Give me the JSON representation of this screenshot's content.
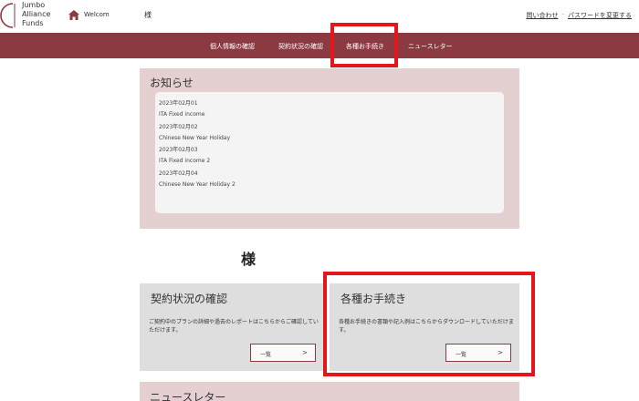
{
  "header": {
    "logo_lines": [
      "Jumbo",
      "Alliance",
      "Funds"
    ],
    "welcome": "Welcom",
    "user_suffix": "様",
    "contact_link": "問い合わせ",
    "separator": "-",
    "password_link": "パスワードを変更する"
  },
  "nav": {
    "items": [
      {
        "label": "個人情報の確認"
      },
      {
        "label": "契約状況の確認"
      },
      {
        "label": "各種お手続き"
      },
      {
        "label": "ニュースレター"
      }
    ]
  },
  "news": {
    "title": "お知らせ",
    "items": [
      {
        "date": "2023年02月01",
        "text": "ITA Fixed income"
      },
      {
        "date": "2023年02月02",
        "text": "Chinese New Year Holiday"
      },
      {
        "date": "2023年02月03",
        "text": "ITA Fixed income 2"
      },
      {
        "date": "2023年02月04",
        "text": "Chinese New Year Holiday 2"
      }
    ]
  },
  "user_name": "様",
  "cards": {
    "contract": {
      "title": "契約状況の確認",
      "description": "ご契約中のプランの詳細や過去のレポートはこちらからご確認していただけます。",
      "button_label": "一覧",
      "button_arrow": ">"
    },
    "procedures": {
      "title": "各種お手続き",
      "description": "各種お手続きの書類や記入例はこちらからダウンロードしていただけます。",
      "button_label": "一覧",
      "button_arrow": ">"
    }
  },
  "newsletter": {
    "title": "ニュースレター"
  },
  "colors": {
    "brand": "#8b3a42",
    "panel_pink": "#e4d0d0",
    "card_gray": "#dedede",
    "highlight_red": "#e3161b"
  }
}
